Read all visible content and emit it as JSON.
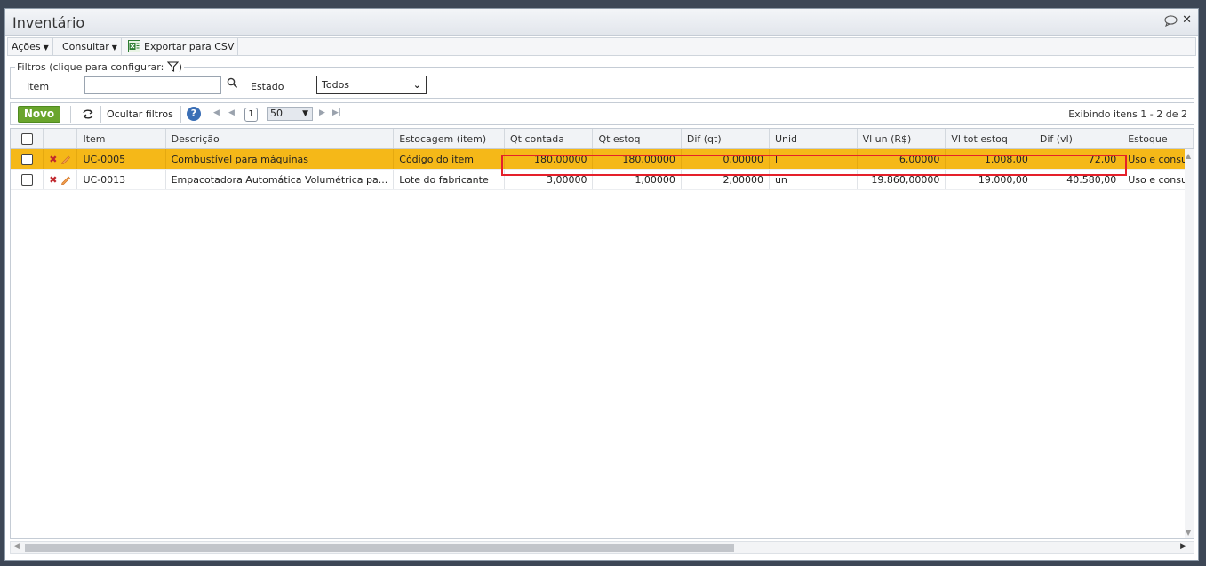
{
  "window": {
    "title": "Inventário"
  },
  "menu": {
    "acoes": "Ações",
    "consultar": "Consultar",
    "export_csv": "Exportar para CSV"
  },
  "filters": {
    "legend": "Filtros (clique para configurar:",
    "legend_close": ")",
    "item_label": "Item",
    "item_value": "",
    "estado_label": "Estado",
    "estado_value": "Todos"
  },
  "toolbar": {
    "novo": "Novo",
    "ocultar_filtros": "Ocultar filtros",
    "help": "?",
    "page": "1",
    "page_size": "50",
    "exibindo": "Exibindo itens 1 - 2 de 2"
  },
  "grid": {
    "columns": [
      "Item",
      "Descrição",
      "Estocagem (item)",
      "Qt contada",
      "Qt estoq",
      "Dif (qt)",
      "Unid",
      "Vl un (R$)",
      "Vl tot estoq",
      "Dif (vl)",
      "Estoque"
    ],
    "rows": [
      {
        "item": "UC-0005",
        "descricao": "Combustível para máquinas",
        "estocagem": "Código do item",
        "qt_contada": "180,00000",
        "qt_estoq": "180,00000",
        "dif_qt": "0,00000",
        "unid": "l",
        "vl_un": "6,00000",
        "vl_tot": "1.008,00",
        "dif_vl": "72,00",
        "estoque": "Uso e consu"
      },
      {
        "item": "UC-0013",
        "descricao": "Empacotadora Automática Volumétrica pa...",
        "estocagem": "Lote do fabricante",
        "qt_contada": "3,00000",
        "qt_estoq": "1,00000",
        "dif_qt": "2,00000",
        "unid": "un",
        "vl_un": "19.860,00000",
        "vl_tot": "19.000,00",
        "dif_vl": "40.580,00",
        "estoque": "Uso e consu"
      }
    ]
  },
  "colors": {
    "selected_row": "#f5b818",
    "highlight": "#e5202a",
    "novo_button": "#6aa52d"
  }
}
